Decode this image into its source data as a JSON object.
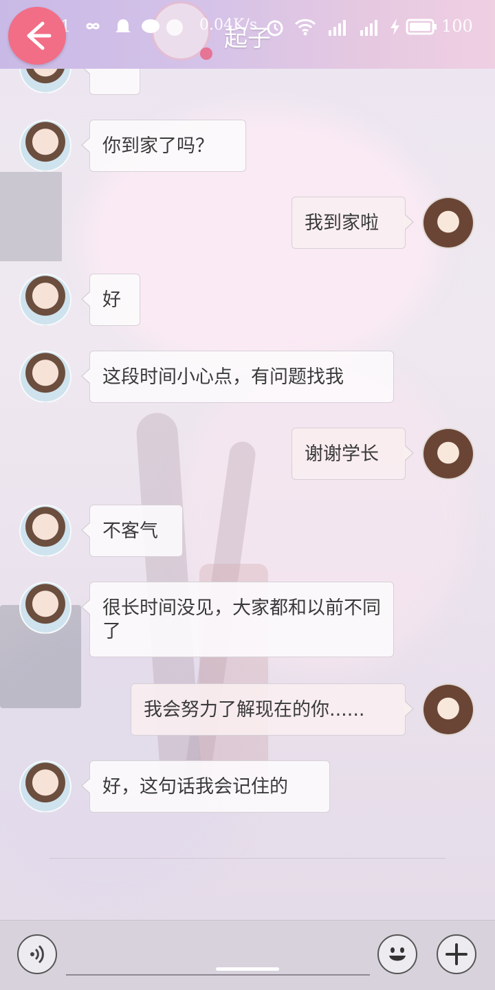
{
  "status_bar": {
    "time": "06:11",
    "net_speed": "0.04K/s",
    "battery": "100"
  },
  "header": {
    "title": "起子"
  },
  "messages": [
    {
      "side": "left",
      "text": "你到家了吗？"
    },
    {
      "side": "right",
      "text": "我到家啦"
    },
    {
      "side": "left",
      "text": "好"
    },
    {
      "side": "left",
      "text": "这段时间小心点，有问题找我"
    },
    {
      "side": "right",
      "text": "谢谢学长"
    },
    {
      "side": "left",
      "text": "不客气"
    },
    {
      "side": "left",
      "text": "很长时间没见，大家都和以前不同了"
    },
    {
      "side": "right",
      "text": "我会努力了解现在的你......"
    },
    {
      "side": "left",
      "text": "好，这句话我会记住的"
    }
  ],
  "icons": {
    "back": "arrow-left-icon",
    "voice": "voice-icon",
    "emoji": "emoji-icon",
    "plus": "plus-icon"
  },
  "colors": {
    "accent": "#f26d86",
    "header_start": "#c9b9e6",
    "header_end": "#efcfe2"
  }
}
